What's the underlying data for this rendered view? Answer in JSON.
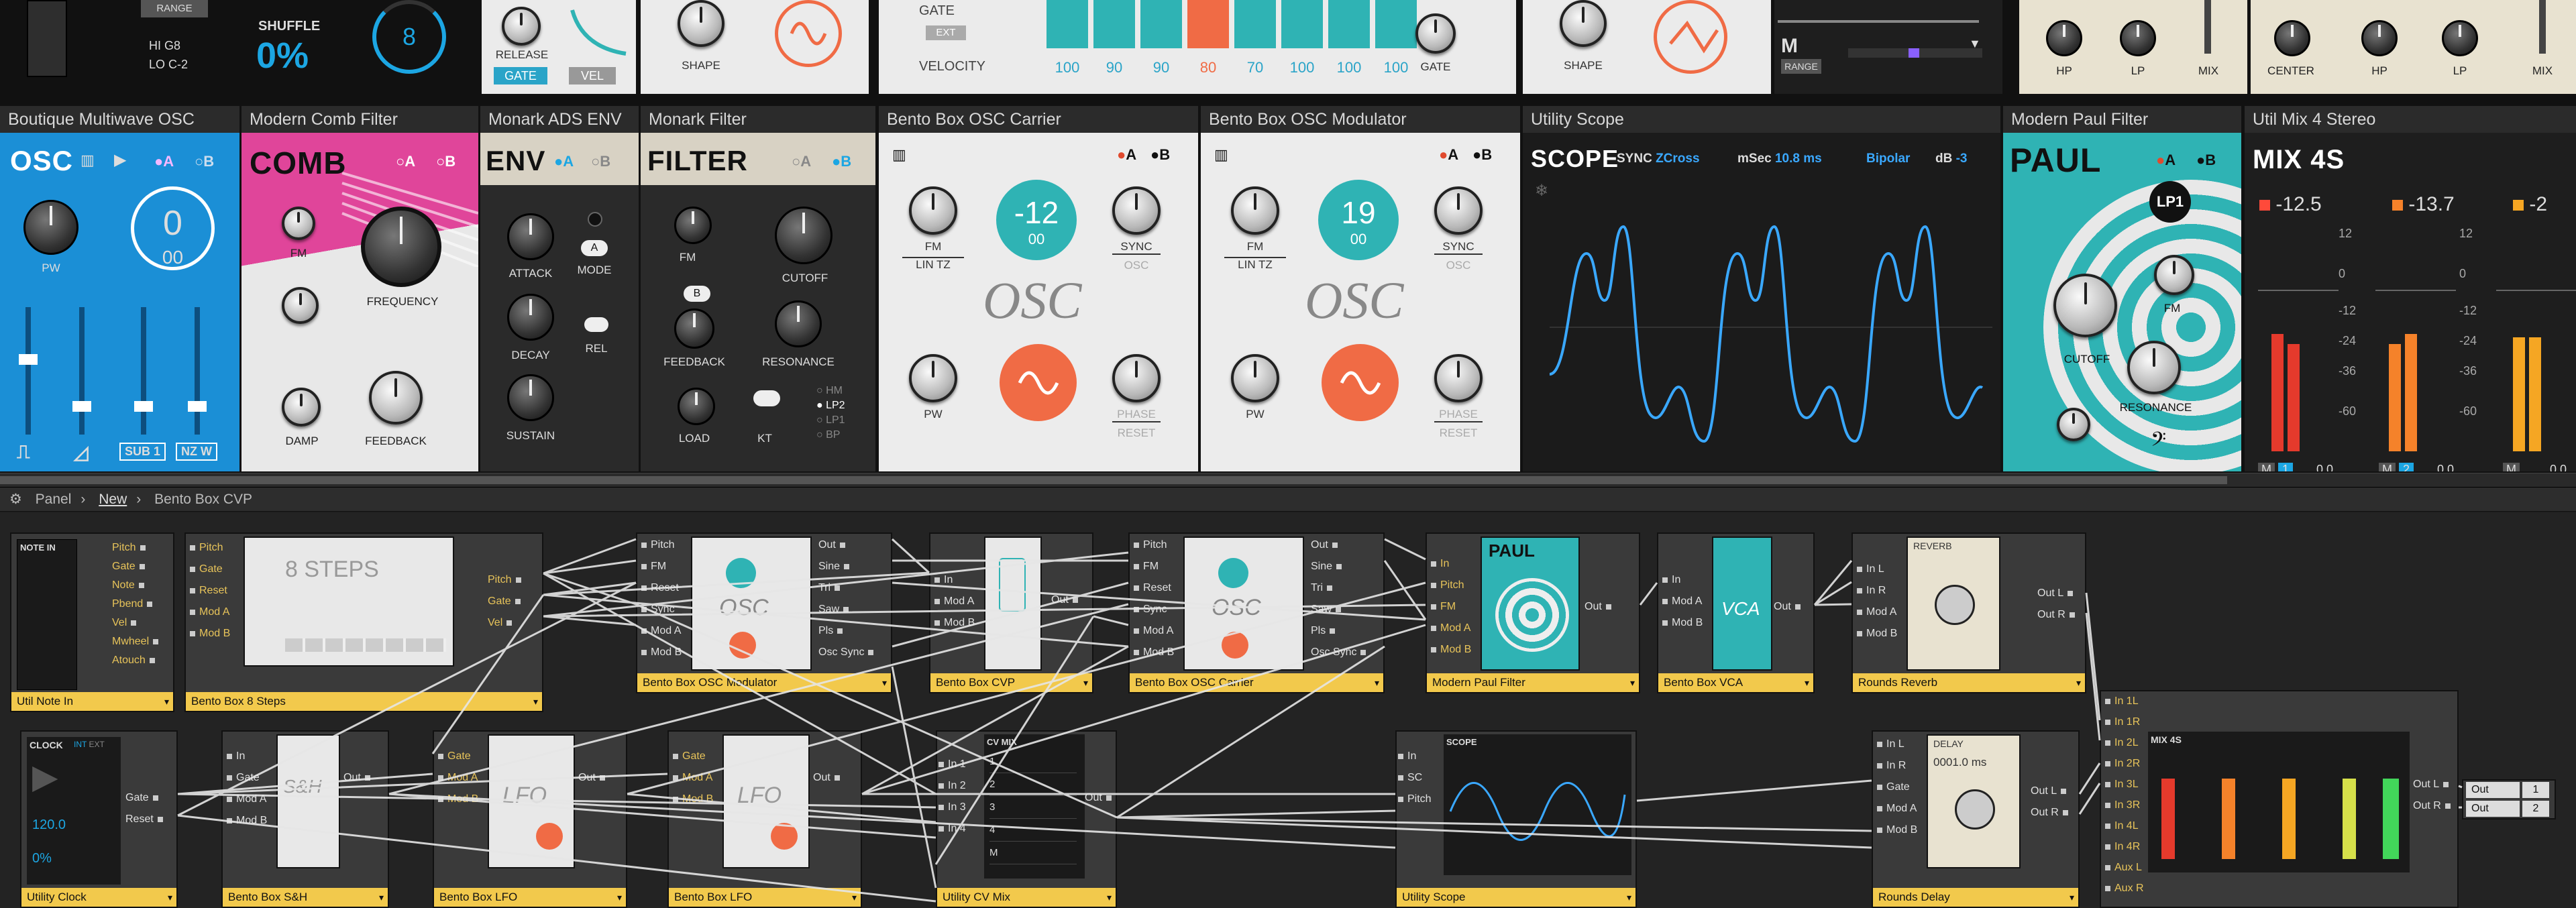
{
  "top_strip": {
    "range": "RANGE",
    "hi": "HI",
    "hi_val": "G8",
    "lo": "LO",
    "lo_val": "C-2",
    "shuffle": "SHUFFLE",
    "shuffle_val": "0%",
    "dial_val": "8",
    "release": "RELEASE",
    "gate": "GATE",
    "vel": "VEL",
    "shape": "SHAPE",
    "gate2": "GATE",
    "ext": "EXT",
    "velocity": "VELOCITY",
    "vel_values": [
      "100",
      "90",
      "90",
      "80",
      "70",
      "100",
      "100",
      "100"
    ],
    "gate3": "GATE",
    "shape2": "SHAPE",
    "m": "M",
    "range2": "RANGE",
    "hp": "HP",
    "lp": "LP",
    "mix": "MIX",
    "center": "CENTER",
    "hp2": "HP",
    "lp2": "LP",
    "mix2": "MIX"
  },
  "rack": [
    {
      "title": "Boutique Multiwave OSC",
      "big": "OSC",
      "a": "A",
      "b": "B",
      "pw": "PW",
      "val": "0",
      "sub": "00",
      "sub1": "SUB 1",
      "nzw": "NZ W"
    },
    {
      "title": "Modern Comb Filter",
      "big": "COMB",
      "a": "A",
      "b": "B",
      "fm": "FM",
      "frequency": "FREQUENCY",
      "damp": "DAMP",
      "feedback": "FEEDBACK"
    },
    {
      "title": "Monark ADS ENV",
      "big": "ENV",
      "a": "A",
      "b": "B",
      "attack": "ATTACK",
      "mode": "MODE",
      "decay": "DECAY",
      "rel": "REL",
      "sustain": "SUSTAIN",
      "a_btn": "A"
    },
    {
      "title": "Monark Filter",
      "big": "FILTER",
      "a": "A",
      "b": "B",
      "fm": "FM",
      "cutoff": "CUTOFF",
      "b_btn": "B",
      "feedback": "FEEDBACK",
      "resonance": "RESONANCE",
      "load": "LOAD",
      "kt": "KT",
      "modes": [
        "HM",
        "LP2",
        "LP1",
        "BP"
      ]
    },
    {
      "title": "Bento Box OSC Carrier",
      "a": "A",
      "b": "B",
      "fm": "FM",
      "lintz": "LIN TZ",
      "val": "-12",
      "sub": "00",
      "sync": "SYNC",
      "osc_small": "OSC",
      "osc": "OSC",
      "pw": "PW",
      "phase": "PHASE",
      "reset": "RESET"
    },
    {
      "title": "Bento Box OSC Modulator",
      "a": "A",
      "b": "B",
      "fm": "FM",
      "lintz": "LIN TZ",
      "val": "19",
      "sub": "00",
      "sync": "SYNC",
      "osc_small": "OSC",
      "osc": "OSC",
      "pw": "PW",
      "phase": "PHASE",
      "reset": "RESET"
    },
    {
      "title": "Utility Scope",
      "big": "SCOPE",
      "sync": "SYNC",
      "zcross": "ZCross",
      "msec": "mSec",
      "msec_val": "10.8 ms",
      "bipolar": "Bipolar",
      "db": "dB",
      "db_val": "-3"
    },
    {
      "title": "Modern Paul Filter",
      "big": "PAUL",
      "a": "A",
      "b": "B",
      "lp1": "LP1",
      "fm": "FM",
      "cutoff": "CUTOFF",
      "resonance": "RESONANCE"
    },
    {
      "title": "Util Mix 4 Stereo",
      "big": "MIX 4S",
      "ch": [
        "-12.5",
        "-13.7",
        "-2"
      ],
      "scale": [
        "12",
        "0",
        "-12",
        "-24",
        "-36",
        "-60"
      ],
      "m": "M",
      "val": "0.0"
    }
  ],
  "breadcrumb": {
    "panel": "Panel",
    "new": "New",
    "current": "Bento Box CVP"
  },
  "patch": {
    "note_in": {
      "name": "Util Note In",
      "title": "NOTE IN",
      "outs": [
        "Pitch",
        "Gate",
        "Note",
        "Pbend",
        "Vel",
        "Mwheel",
        "Atouch"
      ]
    },
    "steps": {
      "name": "Bento Box 8 Steps",
      "thumb": "8 STEPS",
      "ins": [
        "Pitch",
        "Gate",
        "Reset",
        "Mod A",
        "Mod B"
      ],
      "outs": [
        "Pitch",
        "Gate",
        "Vel"
      ]
    },
    "oscmod": {
      "name": "Bento Box OSC Modulator",
      "thumb": "OSC",
      "ins": [
        "Pitch",
        "FM",
        "Reset",
        "Sync",
        "Mod A",
        "Mod B"
      ],
      "outs": [
        "Out",
        "Sine",
        "Tri",
        "Saw",
        "Pls",
        "Osc Sync"
      ]
    },
    "cvp": {
      "name": "Bento Box CVP",
      "ins": [
        "In",
        "Mod A",
        "Mod B"
      ],
      "outs": [
        "Out"
      ]
    },
    "osccar": {
      "name": "Bento Box OSC Carrier",
      "thumb": "OSC",
      "ins": [
        "Pitch",
        "FM",
        "Reset",
        "Sync",
        "Mod A",
        "Mod B"
      ],
      "outs": [
        "Out",
        "Sine",
        "Tri",
        "Saw",
        "Pls",
        "Osc Sync"
      ]
    },
    "paul": {
      "name": "Modern Paul Filter",
      "thumb": "PAUL",
      "ins": [
        "In",
        "Pitch",
        "FM",
        "Mod A",
        "Mod B"
      ],
      "outs": [
        "Out"
      ]
    },
    "vca": {
      "name": "Bento Box VCA",
      "thumb": "VCA",
      "ins": [
        "In",
        "Mod A",
        "Mod B"
      ],
      "outs": [
        "Out"
      ]
    },
    "reverb": {
      "name": "Rounds Reverb",
      "thumb": "REVERB",
      "ins": [
        "In L",
        "In R",
        "Mod A",
        "Mod B"
      ],
      "outs": [
        "Out L",
        "Out R"
      ]
    },
    "clock": {
      "name": "Utility Clock",
      "title": "CLOCK",
      "int": "INT",
      "ext": "EXT",
      "bpm": "120.0",
      "shuffle": "0%",
      "outs": [
        "Gate",
        "Reset"
      ]
    },
    "sh": {
      "name": "Bento Box S&H",
      "thumb": "S&H",
      "ins": [
        "In",
        "Gate",
        "Mod A",
        "Mod B"
      ],
      "outs": [
        "Out"
      ]
    },
    "lfo1": {
      "name": "Bento Box LFO",
      "thumb": "LFO",
      "ins": [
        "Gate",
        "Mod A",
        "Mod B"
      ],
      "outs": [
        "Out"
      ]
    },
    "lfo2": {
      "name": "Bento Box LFO",
      "thumb": "LFO",
      "ins": [
        "Gate",
        "Mod A",
        "Mod B"
      ],
      "outs": [
        "Out"
      ]
    },
    "cvmix": {
      "name": "Utility CV Mix",
      "title": "CV MIX",
      "ins": [
        "In 1",
        "In 2",
        "In 3",
        "In 4"
      ],
      "outs": [
        "Out"
      ],
      "rows": [
        "1",
        "2",
        "3",
        "4",
        "M"
      ]
    },
    "scope": {
      "name": "Utility Scope",
      "title": "SCOPE",
      "ins": [
        "In",
        "SC",
        "Pitch"
      ]
    },
    "delay": {
      "name": "Rounds Delay",
      "title": "DELAY",
      "val": "0001.0 ms",
      "ins": [
        "In L",
        "In R",
        "Gate",
        "Mod A",
        "Mod B"
      ],
      "outs": [
        "Out L",
        "Out R"
      ]
    },
    "mix4s": {
      "name": "Util Mix 4 Stereo",
      "title": "MIX 4S",
      "ins": [
        "In 1L",
        "In 1R",
        "In 2L",
        "In 2R",
        "In 3L",
        "In 3R",
        "In 4L",
        "In 4R",
        "Aux L",
        "Aux R"
      ],
      "outs": [
        "Out L",
        "Out R"
      ]
    },
    "out": {
      "labels": [
        "Out",
        "Out"
      ],
      "nums": [
        "1",
        "2"
      ]
    }
  },
  "colors": {
    "osc_blue": "#1b8fd6",
    "comb_pink": "#e0459a",
    "teal": "#2fb3b4",
    "orange": "#f06b45",
    "gold": "#f2c94c"
  }
}
